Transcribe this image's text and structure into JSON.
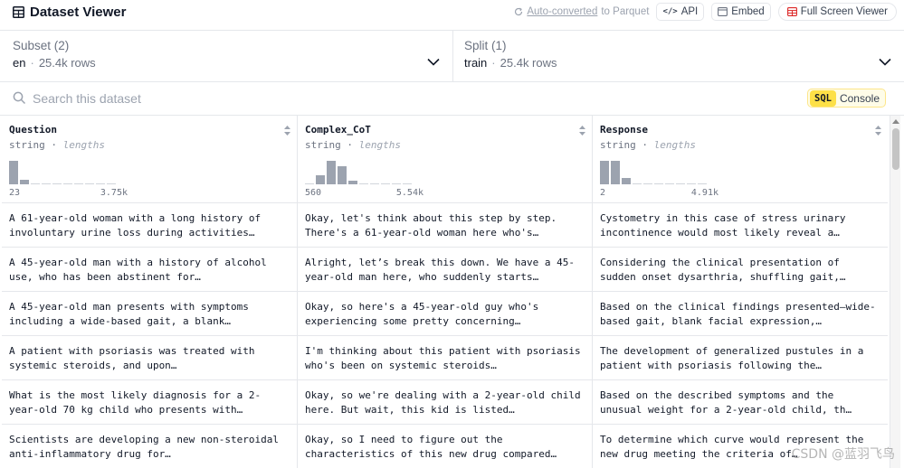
{
  "header": {
    "title": "Dataset Viewer",
    "auto_converted": "Auto-converted",
    "to_parquet": "to Parquet",
    "api_label": "API",
    "embed_label": "Embed",
    "fullscreen_label": "Full Screen Viewer"
  },
  "subset": {
    "label": "Subset (2)",
    "value": "en",
    "rows": "25.4k rows"
  },
  "split": {
    "label": "Split (1)",
    "value": "train",
    "rows": "25.4k rows"
  },
  "search": {
    "placeholder": "Search this dataset"
  },
  "sql": {
    "tag": "SQL",
    "label": "Console"
  },
  "columns": [
    {
      "name": "Question",
      "type": "string",
      "lengths": "lengths",
      "min": "23",
      "max": "3.75k",
      "hist": [
        1.0,
        0.2,
        0,
        0,
        0,
        0,
        0,
        0,
        0,
        0
      ]
    },
    {
      "name": "Complex_CoT",
      "type": "string",
      "lengths": "lengths",
      "min": "560",
      "max": "5.54k",
      "hist": [
        0,
        0.4,
        1.0,
        0.75,
        0.15,
        0,
        0,
        0,
        0,
        0
      ]
    },
    {
      "name": "Response",
      "type": "string",
      "lengths": "lengths",
      "min": "2",
      "max": "4.91k",
      "hist": [
        1.0,
        1.0,
        0.25,
        0,
        0,
        0,
        0,
        0,
        0,
        0
      ]
    }
  ],
  "rows": [
    [
      "A 61-year-old woman with a long history of involuntary urine loss during activities…",
      "Okay, let's think about this step by step. There's a 61-year-old woman here who's…",
      "Cystometry in this case of stress urinary incontinence would most likely reveal a…"
    ],
    [
      "A 45-year-old man with a history of alcohol use, who has been abstinent for…",
      "Alright, let’s break this down. We have a 45-year-old man here, who suddenly starts…",
      "Considering the clinical presentation of sudden onset dysarthria, shuffling gait,…"
    ],
    [
      "A 45-year-old man presents with symptoms including a wide-based gait, a blank…",
      "Okay, so here's a 45-year-old guy who's experiencing some pretty concerning…",
      "Based on the clinical findings presented—wide-based gait, blank facial expression,…"
    ],
    [
      "A patient with psoriasis was treated with systemic steroids, and upon…",
      "I'm thinking about this patient with psoriasis who's been on systemic steroids…",
      "The development of generalized pustules in a patient with psoriasis following the…"
    ],
    [
      "What is the most likely diagnosis for a 2-year-old 70 kg child who presents with…",
      "Okay, so we're dealing with a 2-year-old child here. But wait, this kid is listed…",
      "Based on the described symptoms and the unusual weight for a 2-year-old child, th…"
    ],
    [
      "Scientists are developing a new non-steroidal anti-inflammatory drug for…",
      "Okay, so I need to figure out the characteristics of this new drug compared…",
      "To determine which curve would represent the new drug meeting the criteria of…"
    ]
  ],
  "watermark": "CSDN @蓝羽飞鸟"
}
